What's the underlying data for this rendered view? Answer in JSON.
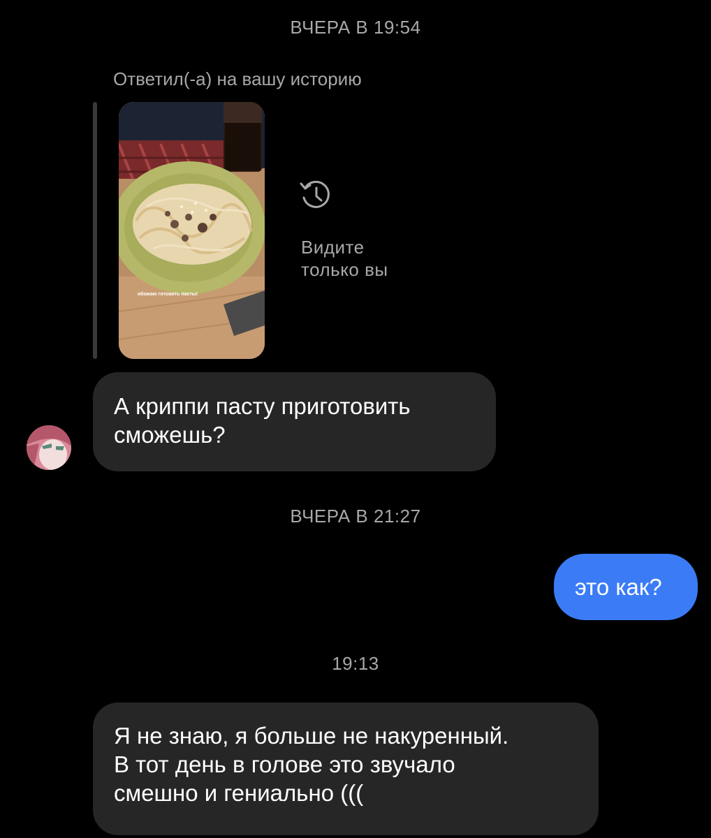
{
  "timestamps": {
    "first": "ВЧЕРА В 19:54",
    "second": "ВЧЕРА В 21:27",
    "third": "19:13"
  },
  "story_reply": {
    "label": "Ответил(-а) на вашу историю",
    "story_caption": "обожаю готовить пасты!",
    "visibility_icon": "history-clock-icon",
    "visibility_text": "Видите\nтолько вы"
  },
  "messages": [
    {
      "direction": "incoming",
      "text": "А криппи пасту приготовить\nсможешь?"
    },
    {
      "direction": "outgoing",
      "text": "это как?"
    },
    {
      "direction": "incoming",
      "text": "Я не знаю, я больше не накуренный.\nВ тот день  в голове это звучало\nсмешно и гениально ((("
    }
  ],
  "colors": {
    "background": "#000000",
    "incoming_bubble": "#262626",
    "outgoing_bubble": "#3b7cf6",
    "secondary_text": "#a8a8a8"
  }
}
